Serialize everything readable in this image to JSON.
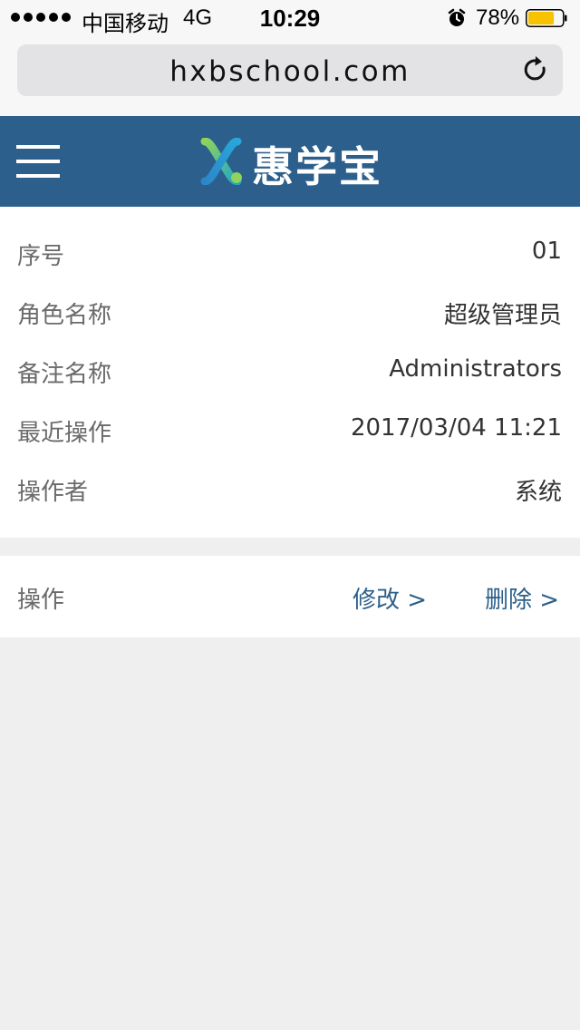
{
  "status_bar": {
    "carrier": "中国移动",
    "network": "4G",
    "time": "10:29",
    "battery_percent": "78%",
    "battery_level": 0.78,
    "battery_color": "#f7c200",
    "icons": [
      "signal-dots-icon",
      "alarm-clock-icon",
      "battery-icon"
    ]
  },
  "browser": {
    "url": "hxbschool.com",
    "icons": [
      "reload-icon"
    ]
  },
  "header": {
    "logo_text": "惠学宝",
    "background_color": "#2c5f8b",
    "icons": [
      "menu-icon",
      "logo-icon"
    ]
  },
  "details": {
    "rows": [
      {
        "label": "序号",
        "value": "01"
      },
      {
        "label": "角色名称",
        "value": "超级管理员"
      },
      {
        "label": "备注名称",
        "value": "Administrators"
      },
      {
        "label": "最近操作",
        "value": "2017/03/04 11:21"
      },
      {
        "label": "操作者",
        "value": "系统"
      }
    ]
  },
  "actions": {
    "label": "操作",
    "edit_label": "修改 >",
    "delete_label": "删除 >",
    "link_color": "#2c5f8b"
  }
}
